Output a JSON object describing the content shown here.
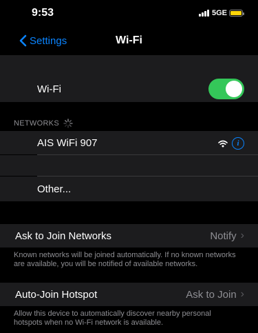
{
  "status": {
    "time": "9:53",
    "network": "5GE"
  },
  "nav": {
    "back_label": "Settings",
    "title": "Wi-Fi"
  },
  "wifi_toggle": {
    "label": "Wi-Fi",
    "enabled": true
  },
  "networks": {
    "header": "NETWORKS",
    "items": [
      {
        "name": "AIS WiFi 907"
      }
    ],
    "other_label": "Other..."
  },
  "ask_to_join": {
    "label": "Ask to Join Networks",
    "value": "Notify",
    "footer": "Known networks will be joined automatically. If no known networks are available, you will be notified of available networks."
  },
  "auto_join": {
    "label": "Auto-Join Hotspot",
    "value": "Ask to Join",
    "footer": "Allow this device to automatically discover nearby personal hotspots when no Wi-Fi network is available."
  },
  "colors": {
    "accent": "#0a84ff",
    "toggle_on": "#34c759",
    "battery": "#ffd60a"
  }
}
